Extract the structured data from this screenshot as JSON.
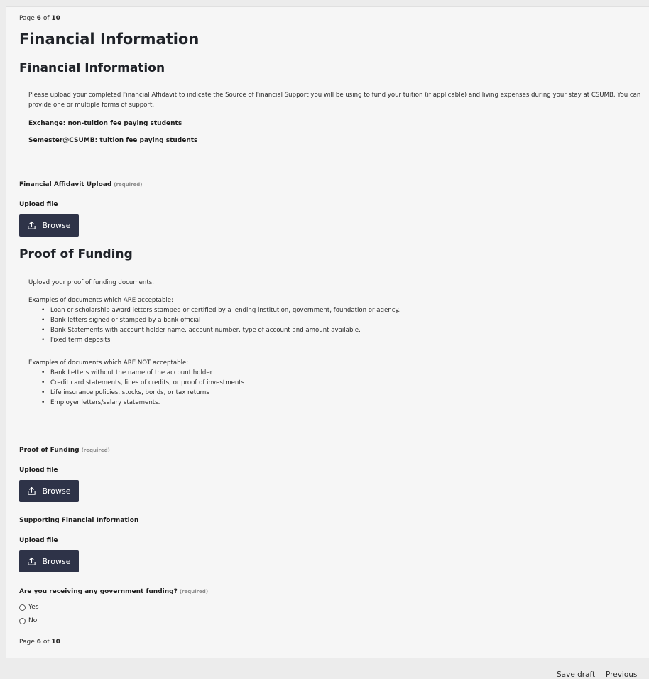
{
  "page_indicator": {
    "prefix": "Page",
    "current": "6",
    "of": "of",
    "total": "10"
  },
  "page_title": "Financial Information",
  "section_financial": {
    "heading": "Financial Information",
    "intro": "Please upload your completed Financial Affidavit to indicate the Source of Financial Support you will be using to fund your tuition (if applicable) and living expenses during your stay at CSUMB. You can provide one or multiple forms of support.",
    "exchange": "Exchange: non-tuition fee paying students",
    "semester": "Semester@CSUMB: tuition fee paying students"
  },
  "affidavit_upload": {
    "label": "Financial Affidavit Upload",
    "required": "(required)",
    "upload_label": "Upload file",
    "button": "Browse"
  },
  "section_proof": {
    "heading": "Proof of Funding",
    "intro": "Upload your proof of funding documents.",
    "acceptable_heading": "Examples of documents which ARE acceptable:",
    "acceptable": [
      "Loan or scholarship award letters stamped or certified by a lending institution, government, foundation or agency.",
      "Bank letters signed or stamped by a bank official",
      "Bank Statements with account holder name, account number, type of account and amount available.",
      "Fixed term deposits"
    ],
    "not_acceptable_heading": "Examples of documents which ARE NOT acceptable:",
    "not_acceptable": [
      "Bank Letters without the name of the account holder",
      "Credit card statements, lines of credits, or proof of investments",
      "Life insurance policies, stocks, bonds, or tax returns",
      "Employer letters/salary statements."
    ]
  },
  "proof_upload": {
    "label": "Proof of Funding",
    "required": "(required)",
    "upload_label": "Upload file",
    "button": "Browse"
  },
  "supporting_upload": {
    "label": "Supporting Financial Information",
    "upload_label": "Upload file",
    "button": "Browse"
  },
  "government_question": {
    "label": "Are you receiving any government funding?",
    "required": "(required)",
    "options": [
      "Yes",
      "No"
    ]
  },
  "footer": {
    "save_draft": "Save draft",
    "previous": "Previous"
  }
}
